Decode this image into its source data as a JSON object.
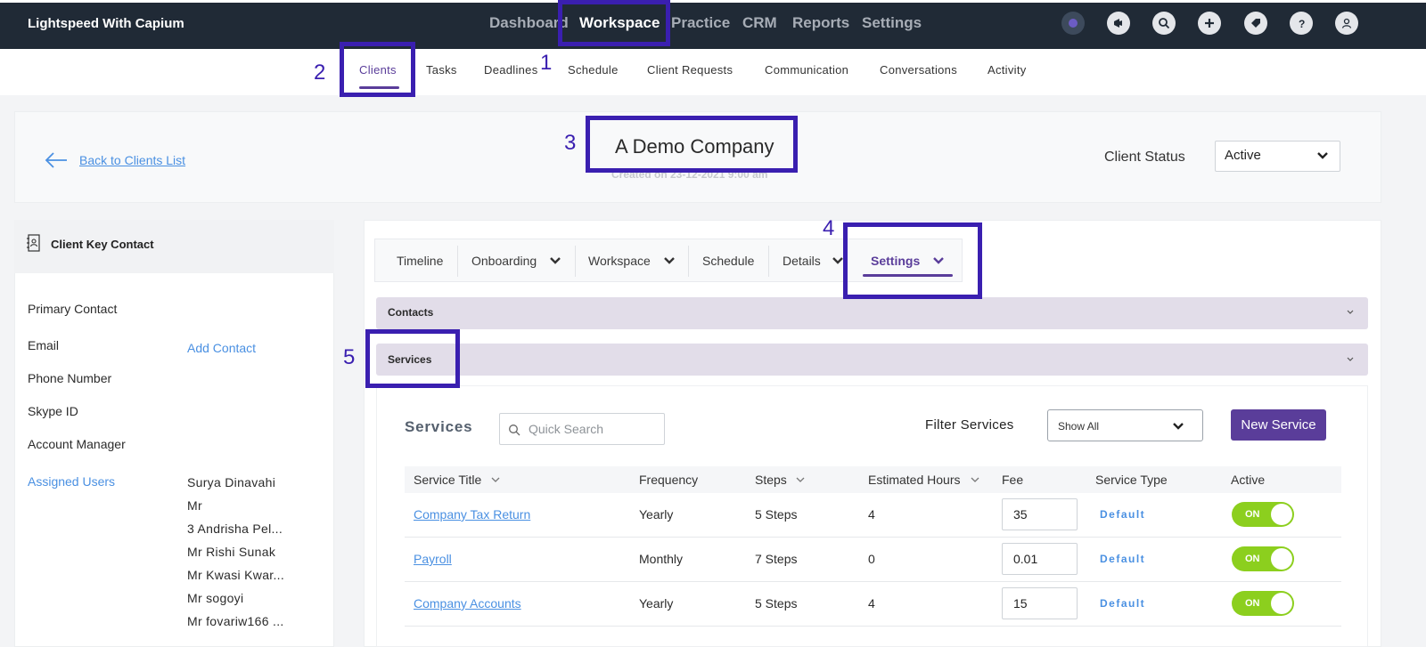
{
  "app": {
    "title": "Lightspeed With Capium"
  },
  "topnav": {
    "items": [
      {
        "label": "Dashboard"
      },
      {
        "label": "Workspace"
      },
      {
        "label": "Practice"
      },
      {
        "label": "CRM"
      },
      {
        "label": "Reports"
      },
      {
        "label": "Settings"
      }
    ],
    "icons": [
      "user-status-icon",
      "megaphone-icon",
      "search-icon",
      "plus-icon",
      "tag-icon",
      "help-icon",
      "profile-icon"
    ]
  },
  "subnav": {
    "items": [
      {
        "label": "Clients"
      },
      {
        "label": "Tasks"
      },
      {
        "label": "Deadlines"
      },
      {
        "label": "Schedule"
      },
      {
        "label": "Client Requests"
      },
      {
        "label": "Communication"
      },
      {
        "label": "Conversations"
      },
      {
        "label": "Activity"
      }
    ]
  },
  "header": {
    "back_label": "Back to Clients List",
    "company_name": "A Demo Company",
    "created": "Created on 23-12-2021 9:00 am",
    "status_label": "Client Status",
    "status_value": "Active"
  },
  "left": {
    "title": "Client Key Contact",
    "fields": [
      "Primary Contact",
      "Email",
      "Phone Number",
      "Skype ID",
      "Account Manager"
    ],
    "add_contact": "Add Contact",
    "assigned_label": "Assigned Users",
    "users": [
      "Surya Dinavahi",
      "Mr",
      "3 Andrisha Pel...",
      "Mr Rishi Sunak",
      "Mr Kwasi Kwar...",
      "Mr sogoyi",
      "Mr fovariw166 ..."
    ]
  },
  "tabs": {
    "items": [
      {
        "label": "Timeline"
      },
      {
        "label": "Onboarding"
      },
      {
        "label": "Workspace"
      },
      {
        "label": "Schedule"
      },
      {
        "label": "Details"
      },
      {
        "label": "Settings"
      }
    ]
  },
  "accordions": {
    "contacts": "Contacts",
    "services": "Services"
  },
  "services": {
    "title": "Services",
    "search_placeholder": "Quick Search",
    "filter_label": "Filter Services",
    "filter_value": "Show All",
    "new_button": "New Service",
    "columns": [
      "Service Title",
      "Frequency",
      "Steps",
      "Estimated Hours",
      "Fee",
      "Service Type",
      "Active"
    ],
    "rows": [
      {
        "title": "Company Tax Return",
        "frequency": "Yearly",
        "steps": "5 Steps",
        "hours": "4",
        "fee": "35",
        "type": "Default",
        "active": "ON"
      },
      {
        "title": "Payroll",
        "frequency": "Monthly",
        "steps": "7 Steps",
        "hours": "0",
        "fee": "0.01",
        "type": "Default",
        "active": "ON"
      },
      {
        "title": "Company Accounts",
        "frequency": "Yearly",
        "steps": "5 Steps",
        "hours": "4",
        "fee": "15",
        "type": "Default",
        "active": "ON"
      }
    ]
  },
  "annotations": [
    "1",
    "2",
    "3",
    "4",
    "5"
  ],
  "colors": {
    "accent": "#5a3d9a",
    "annotation": "#3a1fb0",
    "toggle_on": "#8ccf1e",
    "link": "#4a90e2"
  }
}
